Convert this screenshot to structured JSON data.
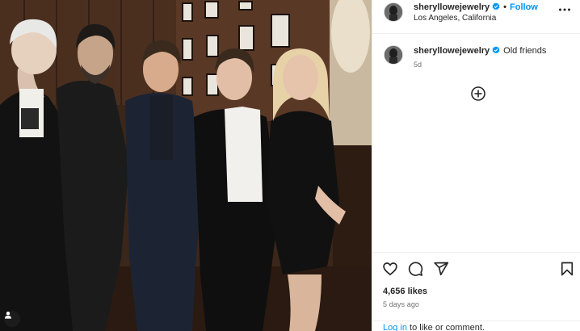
{
  "post": {
    "author": "sheryllowejewelry",
    "location": "Los Angeles, California",
    "follow_label": "Follow",
    "separator": "•",
    "caption_text": "Old friends",
    "caption_age": "5d",
    "likes": "4,656 likes",
    "posted_ago": "5 days ago",
    "login_link": "Log in",
    "login_suffix": " to like or comment."
  },
  "icons": {
    "more": "more-horizontal-icon",
    "verified": "verified-badge-icon",
    "load_more": "plus-circle-icon",
    "like": "heart-icon",
    "comment": "comment-icon",
    "share": "send-icon",
    "save": "bookmark-icon",
    "tagged": "user-tag-icon"
  },
  "colors": {
    "accent": "#0095f6",
    "text": "#262626",
    "muted": "#737373",
    "divider": "#efefef"
  }
}
